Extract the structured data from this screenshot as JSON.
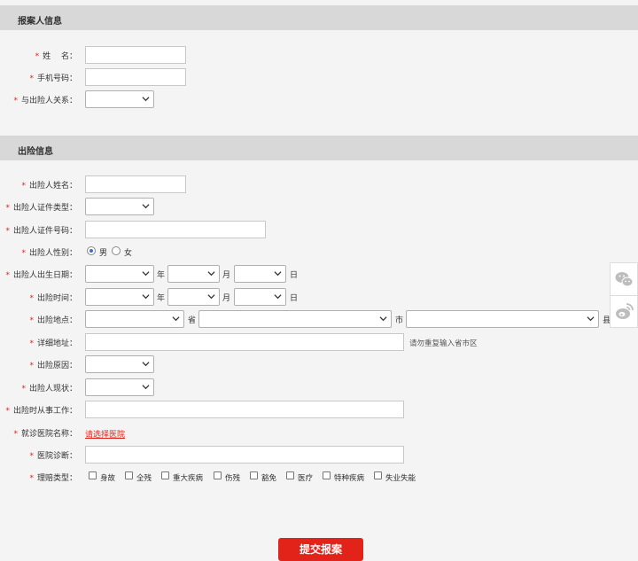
{
  "sections": {
    "reporter": "报案人信息",
    "accident": "出险信息"
  },
  "reporter": {
    "name_label": "姓　 名：",
    "phone_label": "手机号码：",
    "relation_label": "与出险人关系："
  },
  "accident": {
    "name_label": "出险人姓名：",
    "id_type_label": "出险人证件类型：",
    "id_no_label": "出险人证件号码：",
    "gender_label": "出险人性别：",
    "gender_male": "男",
    "gender_female": "女",
    "gender_selected": "男",
    "birth_label": "出险人出生日期：",
    "time_label": "出险时间：",
    "unit_year": "年",
    "unit_month": "月",
    "unit_day": "日",
    "place_label": "出险地点：",
    "unit_province": "省",
    "unit_city": "市",
    "unit_county": "县",
    "address_label": "详细地址：",
    "address_hint": "请勿重复输入省市区",
    "cause_label": "出险原因：",
    "status_label": "出险人现状：",
    "work_label": "出险时从事工作：",
    "hospital_label": "就诊医院名称：",
    "hospital_link": "请选择医院",
    "diagnosis_label": "医院诊断：",
    "claim_type_label": "理赔类型：",
    "claim_types": [
      "身故",
      "全残",
      "重大疾病",
      "伤残",
      "豁免",
      "医疗",
      "特种疾病",
      "失业失能"
    ]
  },
  "required_mark": "*",
  "submit_label": "提交报案",
  "side_icons": [
    "wechat-icon",
    "weibo-icon"
  ]
}
